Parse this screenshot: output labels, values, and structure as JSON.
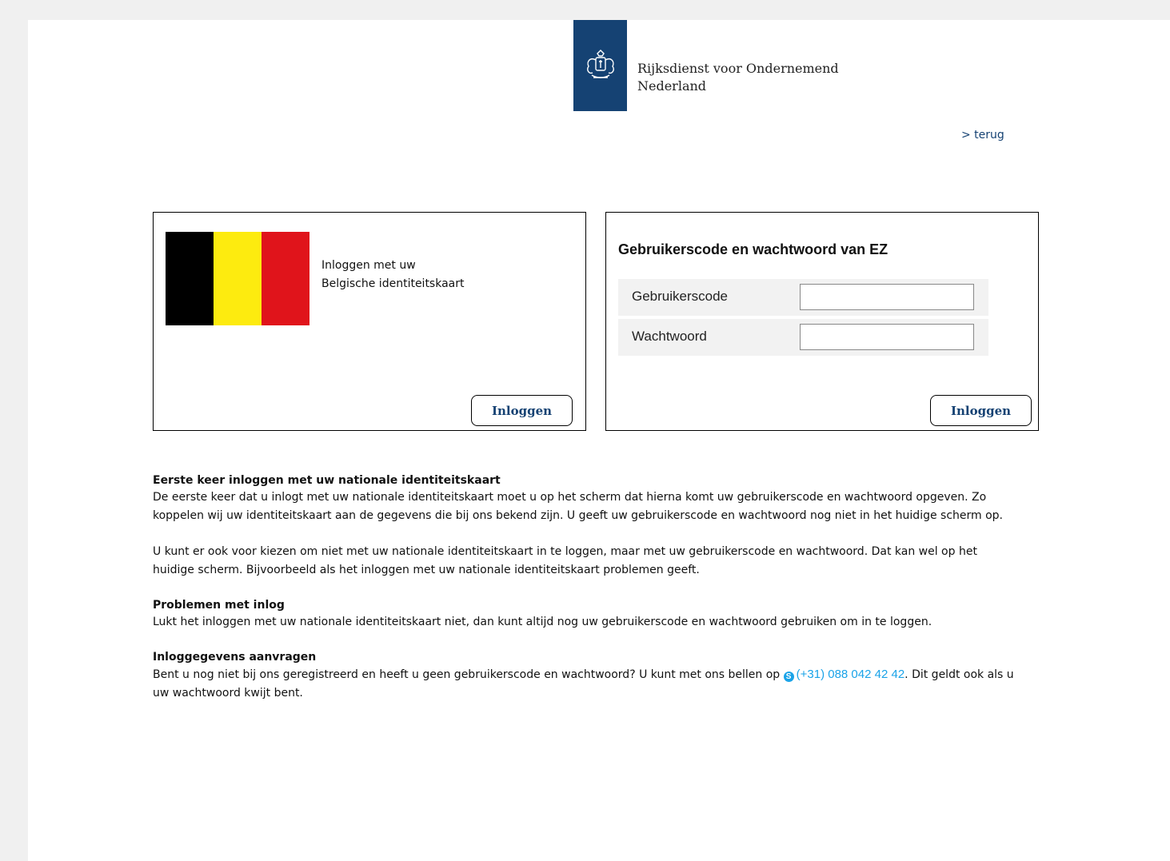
{
  "header": {
    "org_name_line1": "Rijksdienst voor Ondernemend",
    "org_name_line2": "Nederland",
    "back_link": "> terug",
    "logo_icon": "rijkswapen-icon",
    "logo_color": "#154273"
  },
  "eid_panel": {
    "flag_icon": "belgian-flag-icon",
    "text_line1": "Inloggen met uw",
    "text_line2": "Belgische identiteitskaart",
    "button_label": "Inloggen"
  },
  "login_panel": {
    "title": "Gebruikerscode en wachtwoord van EZ",
    "username_label": "Gebruikerscode",
    "username_value": "",
    "password_label": "Wachtwoord",
    "password_value": "",
    "button_label": "Inloggen"
  },
  "info": {
    "section1_title": "Eerste keer inloggen met uw nationale identiteitskaart",
    "section1_text": "De eerste keer dat u inlogt met uw nationale identiteitskaart moet u op het scherm dat hierna komt uw gebruikerscode en wachtwoord opgeven. Zo koppelen wij uw identiteitskaart aan de gegevens die bij ons bekend zijn. U geeft uw gebruikerscode en wachtwoord nog niet in het huidige scherm op.",
    "section1_text2": "U kunt er ook voor kiezen om niet met uw nationale identiteitskaart in te loggen, maar met uw gebruikerscode en wachtwoord. Dat kan wel op het huidige scherm. Bijvoorbeeld als het inloggen met uw nationale identiteitskaart problemen geeft.",
    "section2_title": "Problemen met inlog",
    "section2_text": "Lukt het inloggen met uw nationale identiteitskaart niet, dan kunt altijd nog uw gebruikerscode en wachtwoord gebruiken om in te loggen.",
    "section3_title": "Inloggegevens aanvragen",
    "section3_text_before": "Bent u nog niet bij ons geregistreerd en heeft u geen gebruikerscode en wachtwoord? U kunt met ons bellen op ",
    "phone": "(+31) 088 042 42 42",
    "section3_text_after": ". Dit geldt ook als u uw wachtwoord kwijt bent.",
    "phone_icon": "skype-icon"
  }
}
